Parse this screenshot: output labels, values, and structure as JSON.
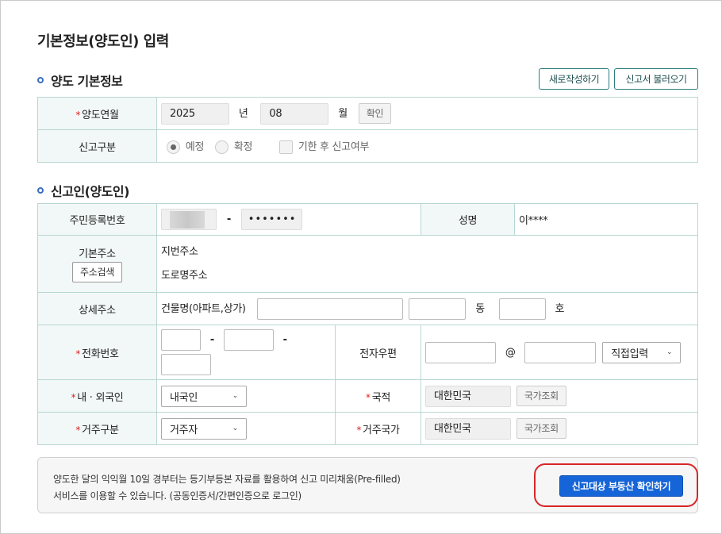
{
  "page_title": "기본정보(양도인) 입력",
  "section1": {
    "title": "양도 기본정보",
    "btn_new": "새로작성하기",
    "btn_load": "신고서 불러오기",
    "month_label": "양도연월",
    "year_value": "2025",
    "year_unit": "년",
    "month_value": "08",
    "month_unit": "월",
    "confirm_btn": "확인",
    "type_label": "신고구분",
    "radio_planned": "예정",
    "radio_final": "확정",
    "late_check": "기한 후 신고여부"
  },
  "section2": {
    "title": "신고인(양도인)",
    "rrn_label": "주민등록번호",
    "rrn_dash": "-",
    "rrn_back": "•••••••",
    "name_label": "성명",
    "name_value": "이****",
    "addr_label": "기본주소",
    "addr_search_btn": "주소검색",
    "lot_addr": "지번주소",
    "road_addr": "도로명주소",
    "detail_label": "상세주소",
    "building_label": "건물명(아파트,상가)",
    "dong_unit": "동",
    "ho_unit": "호",
    "phone_label": "전화번호",
    "phone_dash": "-",
    "email_label": "전자우편",
    "email_at": "@",
    "email_domain_select": "직접입력",
    "residency_label": "내 · 외국인",
    "residency_value": "내국인",
    "nationality_label": "국적",
    "nationality_value": "대한민국",
    "country_search_btn": "국가조회",
    "resident_type_label": "거주구분",
    "resident_type_value": "거주자",
    "residence_country_label": "거주국가",
    "residence_country_value": "대한민국"
  },
  "notice": {
    "line1": "양도한 달의 익익월 10일 경부터는 등기부등본 자료를 활용하여 신고 미리채움(Pre-filled)",
    "line2": "서비스를 이용할 수 있습니다. (공동인증서/간편인증으로 로그인)",
    "action_btn": "신고대상 부동산 확인하기"
  },
  "colors": {
    "accent": "#1565d8",
    "table_border": "#b8d7d2",
    "label_bg": "#f2f8f7",
    "required": "#d22",
    "highlight": "#d6262a"
  }
}
